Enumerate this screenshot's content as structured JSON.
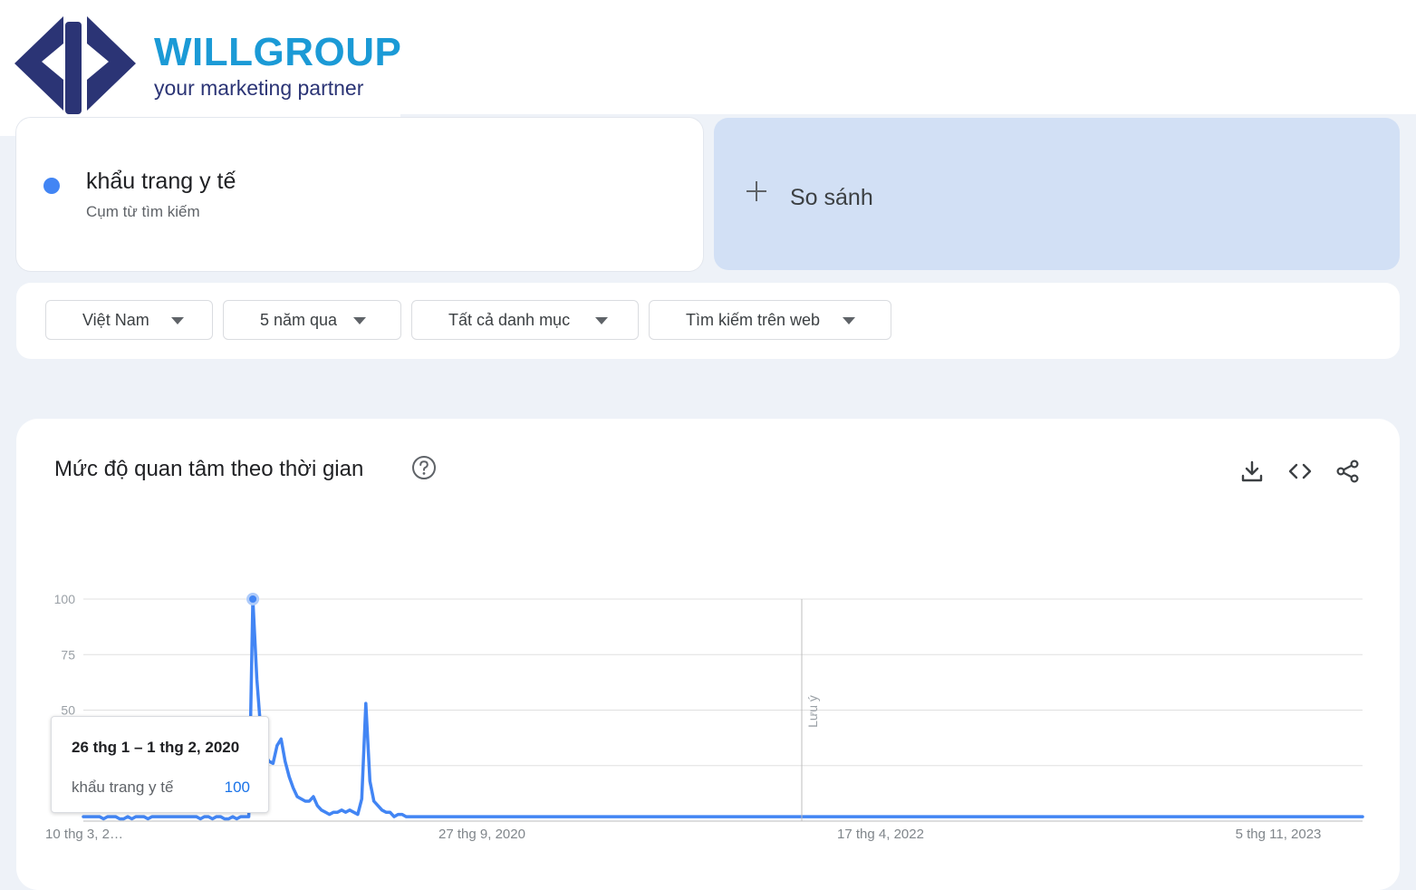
{
  "brand": {
    "name": "WILLGROUP",
    "tagline": "your marketing partner",
    "colors": {
      "name": "#1b9ad6",
      "mark": "#2b3475"
    }
  },
  "search_term": {
    "name": "khẩu trang y tế",
    "type": "Cụm từ tìm kiếm",
    "color": "#4285f4"
  },
  "compare": {
    "label": "So sánh",
    "icon": "plus-icon"
  },
  "filters": [
    {
      "label": "Việt Nam",
      "icon": "dropdown-caret-icon"
    },
    {
      "label": "5 năm qua",
      "icon": "dropdown-caret-icon"
    },
    {
      "label": "Tất cả danh mục",
      "icon": "dropdown-caret-icon"
    },
    {
      "label": "Tìm kiếm trên web",
      "icon": "dropdown-caret-icon"
    }
  ],
  "panel": {
    "title": "Mức độ quan tâm theo thời gian",
    "icons": [
      "help-icon",
      "download-icon",
      "embed-code-icon",
      "share-icon"
    ]
  },
  "tooltip": {
    "date": "26 thg 1 – 1 thg 2, 2020",
    "term": "khẩu trang y tế",
    "value": "100"
  },
  "chart_data": {
    "type": "line",
    "ylim": [
      0,
      100
    ],
    "yticks": [
      "100",
      "75",
      "50",
      "25"
    ],
    "xtick_labels": [
      "10 thg 3, 2…",
      "27 thg 9, 2020",
      "17 thg 4, 2022",
      "5 thg 11, 2023"
    ],
    "note_label": "Lưu ý",
    "line_color": "#4285f4",
    "grid": true,
    "series": [
      {
        "name": "khẩu trang y tế",
        "x_start": "2019-03-10",
        "interval": "week",
        "values": [
          2,
          2,
          2,
          2,
          2,
          1,
          2,
          2,
          2,
          1,
          1,
          2,
          1,
          2,
          2,
          2,
          1,
          2,
          2,
          2,
          2,
          2,
          2,
          2,
          2,
          2,
          2,
          2,
          2,
          1,
          2,
          2,
          1,
          2,
          2,
          1,
          1,
          2,
          1,
          2,
          2,
          2,
          100,
          64,
          40,
          30,
          27,
          26,
          34,
          37,
          27,
          20,
          15,
          11,
          10,
          9,
          9,
          11,
          7,
          5,
          4,
          3,
          4,
          4,
          5,
          4,
          5,
          4,
          3,
          10,
          53,
          18,
          9,
          7,
          5,
          4,
          4,
          2,
          3,
          3,
          2,
          2,
          2,
          2,
          2,
          2,
          2,
          2,
          2,
          2,
          2,
          2,
          2,
          2,
          2,
          2,
          2,
          2,
          2,
          2,
          2,
          2,
          2,
          2,
          2,
          2,
          2,
          2,
          2,
          2,
          2,
          2,
          2,
          2,
          2,
          2,
          2,
          2,
          2,
          2,
          2,
          2,
          2,
          2,
          2,
          2,
          2,
          2,
          2,
          2,
          2,
          2,
          2,
          2,
          2,
          2,
          2,
          2,
          2,
          2,
          2,
          2,
          2,
          2,
          2,
          2,
          2,
          2,
          2,
          2,
          2,
          2,
          2,
          2,
          2,
          2,
          2,
          2,
          2,
          2,
          2,
          2,
          2,
          2,
          2,
          2,
          2,
          2,
          2,
          2,
          2,
          2,
          2,
          2,
          2,
          2,
          2,
          2,
          2,
          2,
          2,
          2,
          2,
          2,
          2,
          2,
          2,
          2,
          2,
          2,
          2,
          2,
          2,
          2,
          2,
          2,
          2,
          2,
          2,
          2,
          2,
          2,
          2,
          2,
          2,
          2,
          2,
          2,
          2,
          2,
          2,
          2,
          2,
          2,
          2,
          2,
          2,
          2,
          2,
          2,
          2,
          2,
          2,
          2,
          2,
          2,
          2,
          2,
          2,
          2,
          2,
          2,
          2,
          2,
          2,
          2,
          2,
          2,
          2,
          2,
          2,
          2,
          2,
          2,
          2,
          2,
          2,
          2,
          2,
          2,
          2,
          2,
          2,
          2,
          2,
          2,
          2,
          2,
          2,
          2,
          2,
          2,
          2,
          2,
          2,
          2,
          2,
          2,
          2,
          2,
          2,
          2,
          2,
          2,
          2,
          2,
          2,
          2,
          2,
          2,
          2,
          2,
          2,
          2,
          2,
          2,
          2,
          2,
          2,
          2,
          2,
          2,
          2,
          2,
          2,
          2,
          2,
          2,
          2,
          2,
          2,
          2,
          2,
          2,
          2,
          2,
          2,
          2,
          2,
          2,
          2,
          2,
          2,
          2,
          2,
          2,
          2,
          2
        ]
      }
    ]
  }
}
